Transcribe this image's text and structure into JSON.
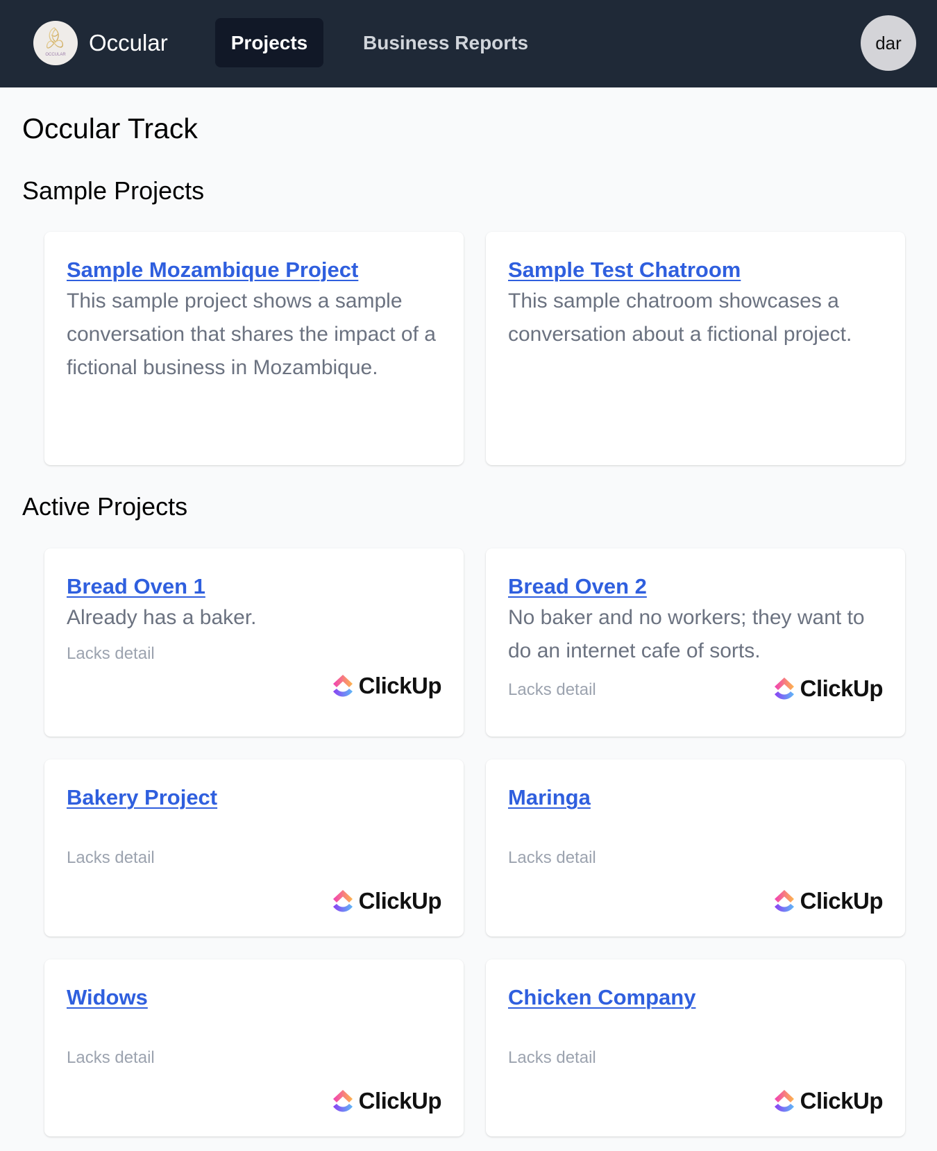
{
  "header": {
    "brand": "Occular",
    "logo_text": "OCCULAR",
    "nav": [
      {
        "label": "Projects",
        "active": true
      },
      {
        "label": "Business Reports",
        "active": false
      }
    ],
    "avatar_initials": "dar"
  },
  "page_title": "Occular Track",
  "sample_section": {
    "title": "Sample Projects",
    "projects": [
      {
        "title": "Sample Mozambique Project",
        "description": "This sample project shows a sample conversation that shares the impact of a fictional business in Mozambique."
      },
      {
        "title": "Sample Test Chatroom",
        "description": "This sample chatroom showcases a conversation about a fictional project."
      }
    ]
  },
  "active_section": {
    "title": "Active Projects",
    "projects": [
      {
        "title": "Bread Oven 1",
        "description": "Already has a baker.",
        "status": "Lacks detail",
        "integration": "ClickUp"
      },
      {
        "title": "Bread Oven 2",
        "description": "No baker and no workers; they want to do an internet cafe of sorts.",
        "status": "Lacks detail",
        "integration": "ClickUp"
      },
      {
        "title": "Bakery Project",
        "description": "",
        "status": "Lacks detail",
        "integration": "ClickUp"
      },
      {
        "title": "Maringa",
        "description": "",
        "status": "Lacks detail",
        "integration": "ClickUp"
      },
      {
        "title": "Widows",
        "description": "",
        "status": "Lacks detail",
        "integration": "ClickUp"
      },
      {
        "title": "Chicken Company",
        "description": "",
        "status": "Lacks detail",
        "integration": "ClickUp"
      }
    ]
  },
  "colors": {
    "header_bg": "#1f2937",
    "active_tab_bg": "#111827",
    "link": "#2f5fde",
    "description": "#6b7280",
    "status": "#9ca3af",
    "page_bg": "#f9fafb"
  }
}
